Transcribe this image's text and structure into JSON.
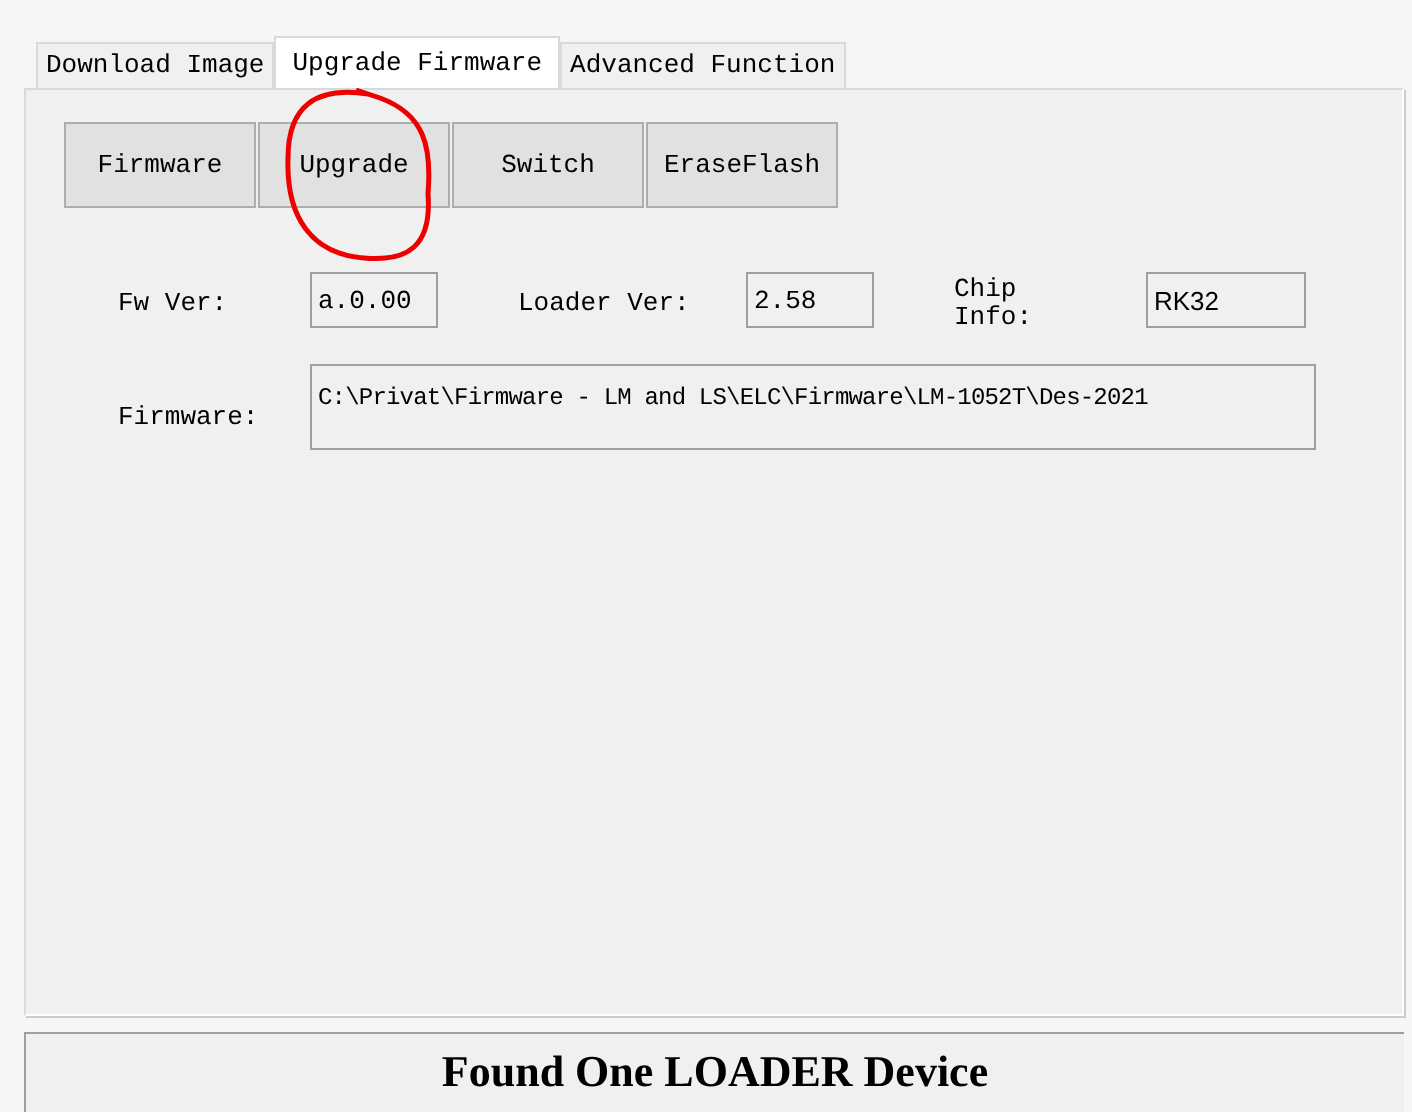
{
  "tabs": [
    {
      "label": "Download Image",
      "selected": false
    },
    {
      "label": "Upgrade Firmware",
      "selected": true
    },
    {
      "label": "Advanced Function",
      "selected": false
    }
  ],
  "buttons": [
    "Firmware",
    "Upgrade",
    "Switch",
    "EraseFlash"
  ],
  "info": [
    {
      "label": "Fw Ver:",
      "value": "a.0.00"
    },
    {
      "label": "Loader Ver:",
      "value": "2.58"
    },
    {
      "label": "Chip Info:",
      "value": "RK32"
    }
  ],
  "firmware": {
    "label": "Firmware:",
    "value": "C:\\Privat\\Firmware - LM and LS\\ELC\\Firmware\\LM-1052T\\Des-2021"
  },
  "status_bar": "Found One LOADER Device"
}
